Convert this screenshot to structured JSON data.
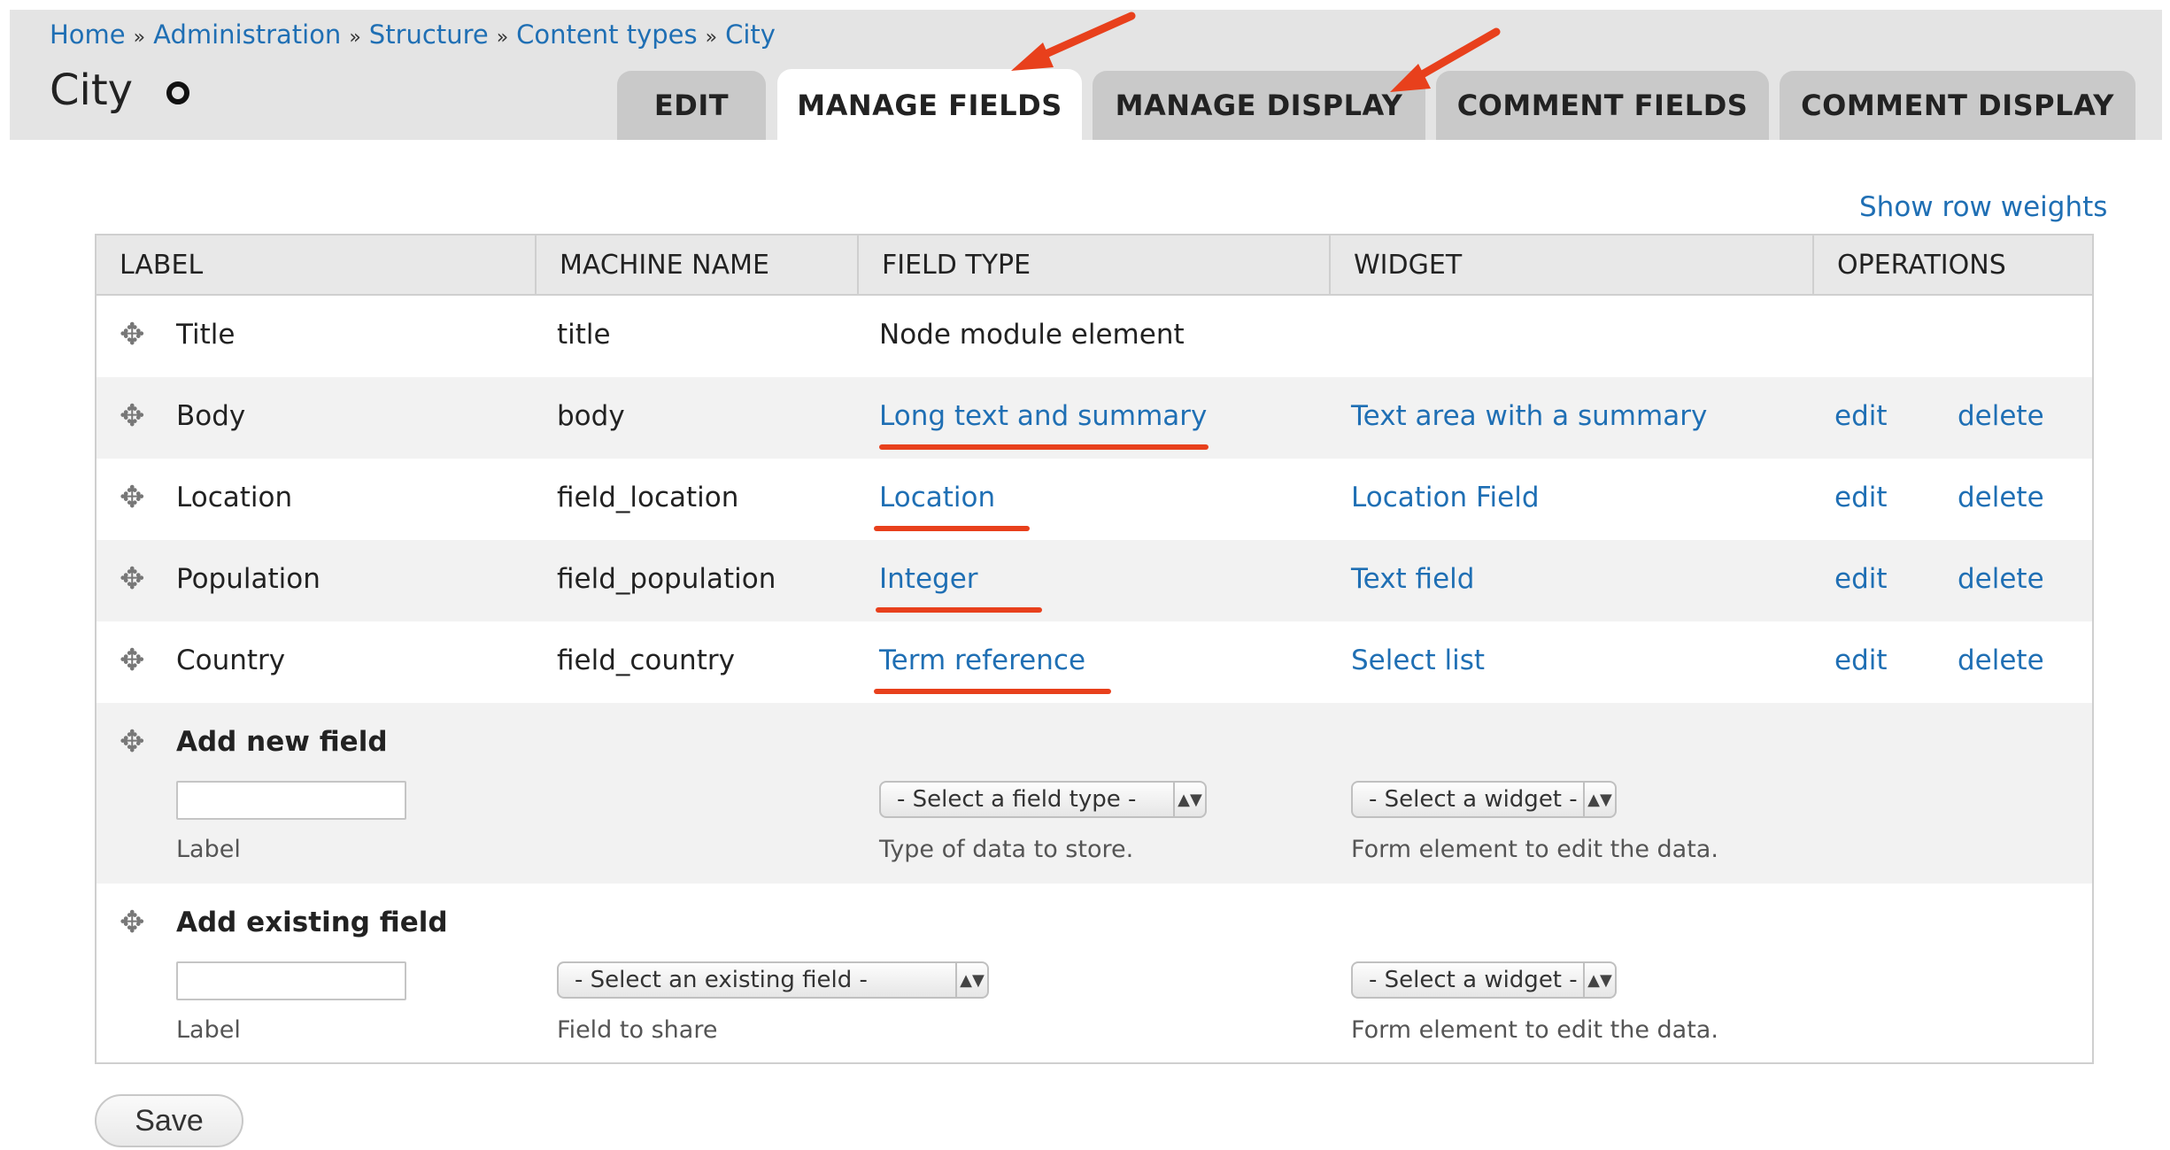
{
  "breadcrumb": {
    "items": [
      "Home",
      "Administration",
      "Structure",
      "Content types",
      "City"
    ],
    "separator": "»"
  },
  "page": {
    "title": "City",
    "title_icon": "gear-icon"
  },
  "tabs": [
    {
      "label": "EDIT",
      "active": false
    },
    {
      "label": "MANAGE FIELDS",
      "active": true
    },
    {
      "label": "MANAGE DISPLAY",
      "active": false
    },
    {
      "label": "COMMENT FIELDS",
      "active": false
    },
    {
      "label": "COMMENT DISPLAY",
      "active": false
    }
  ],
  "show_row_weights": "Show row weights",
  "table": {
    "headers": [
      "LABEL",
      "MACHINE NAME",
      "FIELD TYPE",
      "WIDGET",
      "OPERATIONS"
    ],
    "rows": [
      {
        "label": "Title",
        "machine": "title",
        "type": "Node module element",
        "widget": "",
        "edit": "",
        "delete": ""
      },
      {
        "label": "Body",
        "machine": "body",
        "type": "Long text and summary",
        "widget": "Text area with a summary",
        "edit": "edit",
        "delete": "delete"
      },
      {
        "label": "Location",
        "machine": "field_location",
        "type": "Location",
        "widget": "Location Field",
        "edit": "edit",
        "delete": "delete"
      },
      {
        "label": "Population",
        "machine": "field_population",
        "type": "Integer",
        "widget": "Text field",
        "edit": "edit",
        "delete": "delete"
      },
      {
        "label": "Country",
        "machine": "field_country",
        "type": "Term reference",
        "widget": "Select list",
        "edit": "edit",
        "delete": "delete"
      }
    ],
    "add_new": {
      "title": "Add new field",
      "label_caption": "Label",
      "field_type_select": "- Select a field type -",
      "field_type_caption": "Type of data to store.",
      "widget_select": "- Select a widget -",
      "widget_caption": "Form element to edit the data."
    },
    "add_existing": {
      "title": "Add existing field",
      "label_caption": "Label",
      "existing_select": "- Select an existing field -",
      "existing_caption": "Field to share",
      "widget_select": "- Select a widget -",
      "widget_caption": "Form element to edit the data."
    }
  },
  "save_label": "Save",
  "colors": {
    "link": "#1f6fb4",
    "annotation": "#e8401c",
    "header_bg": "#e4e4e4"
  },
  "icons": {
    "drag": "drag-handle-icon",
    "select_arrows": "up-down-arrows-icon"
  }
}
